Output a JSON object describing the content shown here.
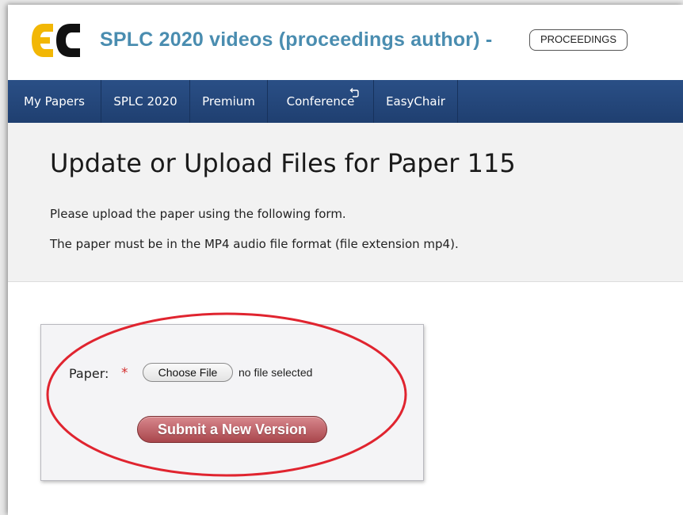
{
  "header": {
    "logo_letters": "EC",
    "title": "SPLC 2020 videos (proceedings author) -",
    "badge": "PROCEEDINGS"
  },
  "nav": {
    "items": [
      {
        "label": "My Papers"
      },
      {
        "label": "SPLC 2020"
      },
      {
        "label": "Premium"
      },
      {
        "label": "Conference"
      },
      {
        "label": "EasyChair"
      }
    ]
  },
  "page": {
    "title": "Update or Upload Files for Paper 115",
    "description_1": "Please upload the paper using the following form.",
    "description_2": "The paper must be in the MP4 audio file format (file extension mp4)."
  },
  "form": {
    "field_label": "Paper:",
    "required_mark": "*",
    "choose_file_label": "Choose File",
    "file_status": "no file selected",
    "submit_label": "Submit a New Version"
  },
  "colors": {
    "nav_background": "#24477d",
    "title_accent": "#4a8db0",
    "logo_yellow": "#f2b705",
    "submit_button": "#c06a70",
    "highlight_circle": "#e0242f"
  },
  "icons": {
    "conference_extra": "return-arrow-icon"
  }
}
